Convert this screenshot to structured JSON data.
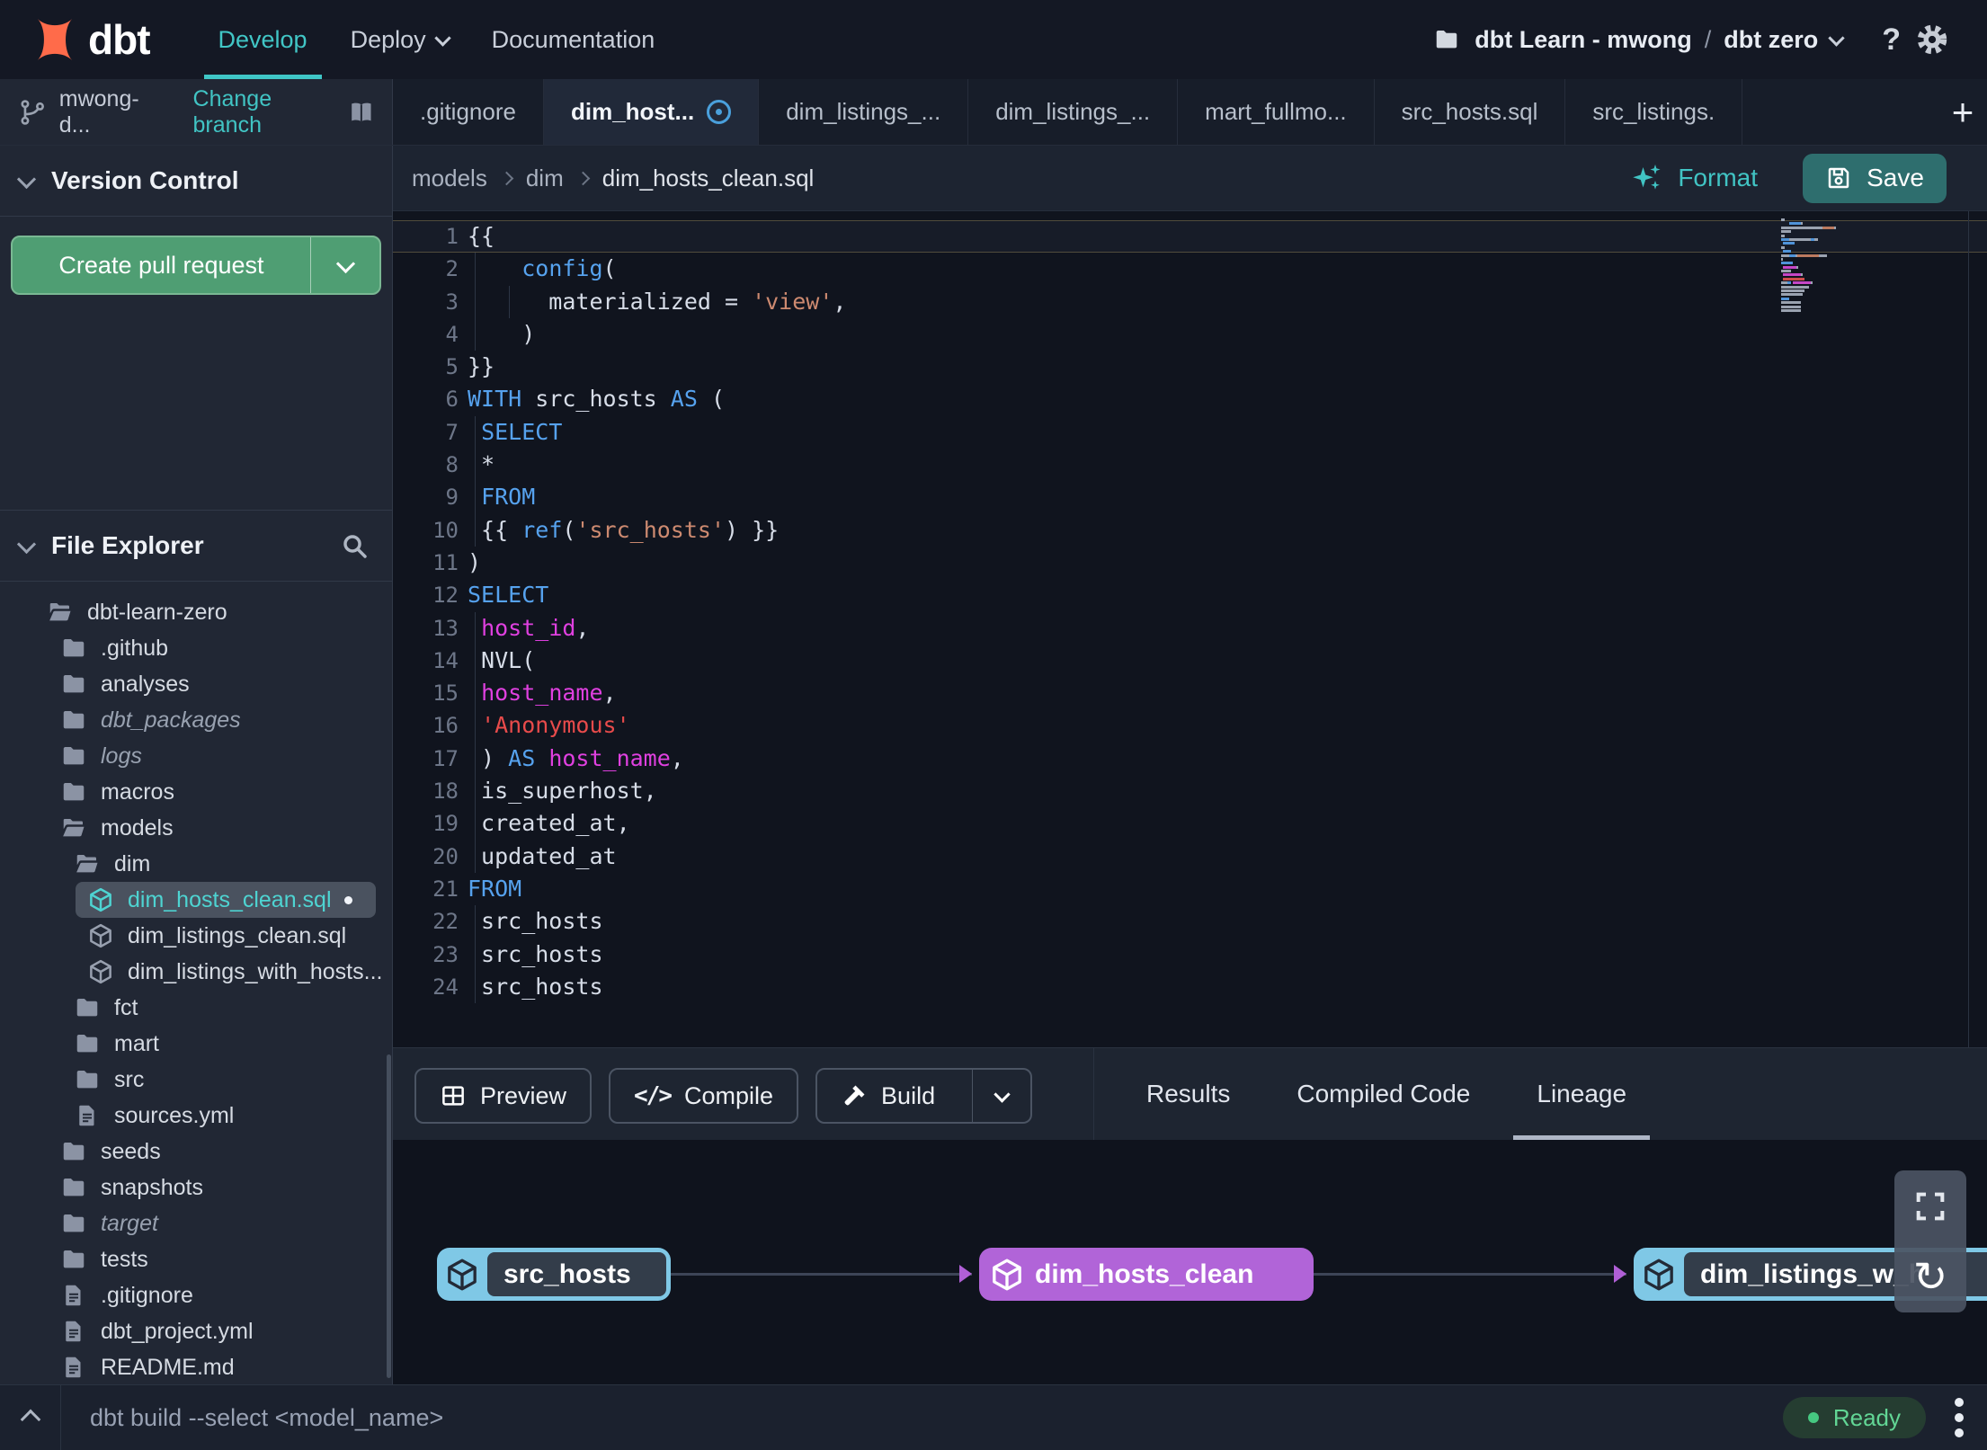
{
  "colors": {
    "accent_teal": "#41c4c4",
    "create_pr_green": "#4f9e73",
    "save_button_teal": "#2e6e6e",
    "ready_green": "#62d695",
    "lineage_node_blue": "#7fc8e6",
    "lineage_node_purple": "#b164d8",
    "lineage_arrow_purple": "#b05fd6",
    "code_keyword": "#56a2ee",
    "code_string": "#cd8a70",
    "code_string_alt": "#e84b4b",
    "code_identifier": "#e040e0",
    "selected_file_teal": "#4ed4d2",
    "modified_tab_blue": "#4aa0dc",
    "logo_orange": "#ff6b4a"
  },
  "icons": {
    "help_glyph": "?",
    "plus_glyph": "+",
    "compile_glyph": "</>",
    "refresh_glyph": "↻",
    "kebab_glyph": "⋮",
    "modified_dot": "•"
  },
  "topnav": {
    "logo_text": "dbt",
    "nav": [
      {
        "label": "Develop",
        "active": true
      },
      {
        "label": "Deploy",
        "caret": true
      },
      {
        "label": "Documentation"
      }
    ],
    "project_account": "dbt Learn - mwong",
    "project_separator": "/",
    "project_name": "dbt zero"
  },
  "branch_bar": {
    "branch_name": "mwong-d...",
    "change_branch_label": "Change branch"
  },
  "editor_tabs": [
    {
      "label": ".gitignore"
    },
    {
      "label": "dim_host...",
      "active": true,
      "modified": true
    },
    {
      "label": "dim_listings_..."
    },
    {
      "label": "dim_listings_..."
    },
    {
      "label": "mart_fullmo..."
    },
    {
      "label": "src_hosts.sql"
    },
    {
      "label": "src_listings."
    }
  ],
  "version_control": {
    "title": "Version Control",
    "create_pr_label": "Create pull request"
  },
  "file_explorer": {
    "title": "File Explorer",
    "tree": [
      {
        "name": "dbt-learn-zero",
        "type": "folder-open",
        "depth": 0
      },
      {
        "name": ".github",
        "type": "folder",
        "depth": 1
      },
      {
        "name": "analyses",
        "type": "folder",
        "depth": 1
      },
      {
        "name": "dbt_packages",
        "type": "folder",
        "depth": 1,
        "italic": true
      },
      {
        "name": "logs",
        "type": "folder",
        "depth": 1,
        "italic": true
      },
      {
        "name": "macros",
        "type": "folder",
        "depth": 1
      },
      {
        "name": "models",
        "type": "folder-open",
        "depth": 1
      },
      {
        "name": "dim",
        "type": "folder-open",
        "depth": 2
      },
      {
        "name": "dim_hosts_clean.sql",
        "type": "model",
        "depth": 3,
        "selected": true,
        "modified": true
      },
      {
        "name": "dim_listings_clean.sql",
        "type": "model",
        "depth": 3
      },
      {
        "name": "dim_listings_with_hosts...",
        "type": "model",
        "depth": 3
      },
      {
        "name": "fct",
        "type": "folder",
        "depth": 2
      },
      {
        "name": "mart",
        "type": "folder",
        "depth": 2
      },
      {
        "name": "src",
        "type": "folder",
        "depth": 2
      },
      {
        "name": "sources.yml",
        "type": "file",
        "depth": 2
      },
      {
        "name": "seeds",
        "type": "folder",
        "depth": 1
      },
      {
        "name": "snapshots",
        "type": "folder",
        "depth": 1
      },
      {
        "name": "target",
        "type": "folder",
        "depth": 1,
        "italic": true
      },
      {
        "name": "tests",
        "type": "folder",
        "depth": 1
      },
      {
        "name": ".gitignore",
        "type": "file",
        "depth": 1
      },
      {
        "name": "dbt_project.yml",
        "type": "file",
        "depth": 1
      },
      {
        "name": "README.md",
        "type": "file",
        "depth": 1
      }
    ]
  },
  "editor": {
    "breadcrumb": [
      "models",
      "dim",
      "dim_hosts_clean.sql"
    ],
    "format_label": "Format",
    "save_label": "Save",
    "lines": [
      {
        "n": 1,
        "cur": true,
        "seg": [
          [
            "{{",
            "p"
          ]
        ]
      },
      {
        "n": 2,
        "g": [
          8
        ],
        "seg": [
          [
            "    ",
            "p"
          ],
          [
            "config",
            "kw"
          ],
          [
            "(",
            "p"
          ]
        ]
      },
      {
        "n": 3,
        "g": [
          8,
          46
        ],
        "seg": [
          [
            "      materialized = ",
            "p"
          ],
          [
            "'view'",
            "str"
          ],
          [
            ",",
            "p"
          ]
        ]
      },
      {
        "n": 4,
        "g": [
          8
        ],
        "seg": [
          [
            "    )",
            "p"
          ]
        ]
      },
      {
        "n": 5,
        "seg": [
          [
            "}}",
            "p"
          ]
        ]
      },
      {
        "n": 6,
        "seg": [
          [
            "WITH",
            "kw"
          ],
          [
            " src_hosts ",
            "p"
          ],
          [
            "AS",
            "kw"
          ],
          [
            " (",
            "p"
          ]
        ]
      },
      {
        "n": 7,
        "g": [
          8
        ],
        "seg": [
          [
            " ",
            "p"
          ],
          [
            "SELECT",
            "kw"
          ]
        ]
      },
      {
        "n": 8,
        "g": [
          8
        ],
        "seg": [
          [
            " *",
            "p"
          ]
        ]
      },
      {
        "n": 9,
        "g": [
          8
        ],
        "seg": [
          [
            " ",
            "p"
          ],
          [
            "FROM",
            "kw"
          ]
        ]
      },
      {
        "n": 10,
        "g": [
          8
        ],
        "seg": [
          [
            " {{ ",
            "p"
          ],
          [
            "ref",
            "kw"
          ],
          [
            "(",
            "p"
          ],
          [
            "'src_hosts'",
            "str"
          ],
          [
            ") }}",
            "p"
          ]
        ]
      },
      {
        "n": 11,
        "seg": [
          [
            ")",
            "p"
          ]
        ]
      },
      {
        "n": 12,
        "seg": [
          [
            "SELECT",
            "kw"
          ]
        ]
      },
      {
        "n": 13,
        "g": [
          8
        ],
        "seg": [
          [
            " ",
            "p"
          ],
          [
            "host_id",
            "id"
          ],
          [
            ",",
            "p"
          ]
        ]
      },
      {
        "n": 14,
        "g": [
          8
        ],
        "seg": [
          [
            " NVL(",
            "p"
          ]
        ]
      },
      {
        "n": 15,
        "g": [
          8
        ],
        "seg": [
          [
            " ",
            "p"
          ],
          [
            "host_name",
            "id"
          ],
          [
            ",",
            "p"
          ]
        ]
      },
      {
        "n": 16,
        "g": [
          8
        ],
        "seg": [
          [
            " ",
            "p"
          ],
          [
            "'Anonymous'",
            "red"
          ]
        ]
      },
      {
        "n": 17,
        "g": [
          8
        ],
        "seg": [
          [
            " ) ",
            "p"
          ],
          [
            "AS",
            "kw"
          ],
          [
            " ",
            "p"
          ],
          [
            "host_name",
            "id"
          ],
          [
            ",",
            "p"
          ]
        ]
      },
      {
        "n": 18,
        "g": [
          8
        ],
        "seg": [
          [
            " is_superhost,",
            "p"
          ]
        ]
      },
      {
        "n": 19,
        "g": [
          8
        ],
        "seg": [
          [
            " created_at,",
            "p"
          ]
        ]
      },
      {
        "n": 20,
        "g": [
          8
        ],
        "seg": [
          [
            " updated_at",
            "p"
          ]
        ]
      },
      {
        "n": 21,
        "seg": [
          [
            "FROM",
            "kw"
          ]
        ]
      },
      {
        "n": 22,
        "g": [
          8
        ],
        "seg": [
          [
            " src_hosts",
            "p"
          ]
        ]
      },
      {
        "n": 23,
        "g": [
          8
        ],
        "seg": [
          [
            " src_hosts",
            "p"
          ]
        ]
      },
      {
        "n": 24,
        "g": [
          8
        ],
        "seg": [
          [
            " src_hosts",
            "p"
          ]
        ]
      }
    ]
  },
  "bottom_panel": {
    "buttons": [
      {
        "label": "Preview",
        "icon": "grid-icon"
      },
      {
        "label": "Compile",
        "icon": "code-icon"
      },
      {
        "label": "Build",
        "icon": "hammer-icon",
        "split": true
      }
    ],
    "tabs": [
      {
        "label": "Results"
      },
      {
        "label": "Compiled Code"
      },
      {
        "label": "Lineage",
        "active": true
      }
    ]
  },
  "lineage": {
    "nodes": [
      {
        "label": "src_hosts",
        "color": "blue"
      },
      {
        "label": "dim_hosts_clean",
        "color": "purple"
      },
      {
        "label": "dim_listings_w_h",
        "color": "blue"
      }
    ]
  },
  "command_bar": {
    "command": "dbt build --select <model_name>",
    "status_label": "Ready"
  }
}
